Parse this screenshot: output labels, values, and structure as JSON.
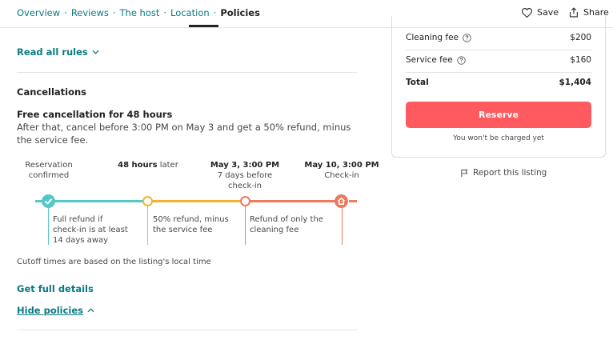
{
  "nav": {
    "links": [
      "Overview",
      "Reviews",
      "The host",
      "Location",
      "Policies"
    ],
    "separator": "·",
    "save_label": "Save",
    "share_label": "Share"
  },
  "policies": {
    "read_all_rules": "Read all rules",
    "cancellations_title": "Cancellations",
    "free_cancel_title": "Free cancellation for 48 hours",
    "free_cancel_desc": "After that, cancel before 3:00 PM on May 3 and get a 50% refund, minus the service fee.",
    "timeline": {
      "points": [
        {
          "lines": [
            "Reservation",
            "confirmed"
          ]
        },
        {
          "bold": "48 hours",
          "rest": " later"
        },
        {
          "lines_bold": "May 3, 3:00 PM",
          "lines": [
            "7 days before",
            "check-in"
          ]
        },
        {
          "lines_bold": "May 10, 3:00 PM",
          "lines": [
            "Check-in"
          ]
        }
      ],
      "captions": [
        [
          "Full refund if",
          "check-in is at least",
          "14 days away"
        ],
        [
          "50% refund, minus",
          "the service fee"
        ],
        [
          "Refund of only the",
          "cleaning fee"
        ]
      ]
    },
    "cutoff_note": "Cutoff times are based on the listing's local time",
    "full_details": "Get full details",
    "hide_policies": "Hide policies"
  },
  "booking": {
    "cleaning_fee_label": "Cleaning fee",
    "cleaning_fee_value": "$200",
    "service_fee_label": "Service fee",
    "service_fee_value": "$160",
    "total_label": "Total",
    "total_value": "$1,404",
    "reserve_label": "Reserve",
    "no_charge_note": "You won't be charged yet",
    "report_label": "Report this listing"
  },
  "colors": {
    "teal": "#0a7a82",
    "line_teal": "#55c7c9",
    "line_yellow": "#f0b432",
    "line_orange": "#ee7a5f",
    "reserve": "#ff5a5f"
  }
}
